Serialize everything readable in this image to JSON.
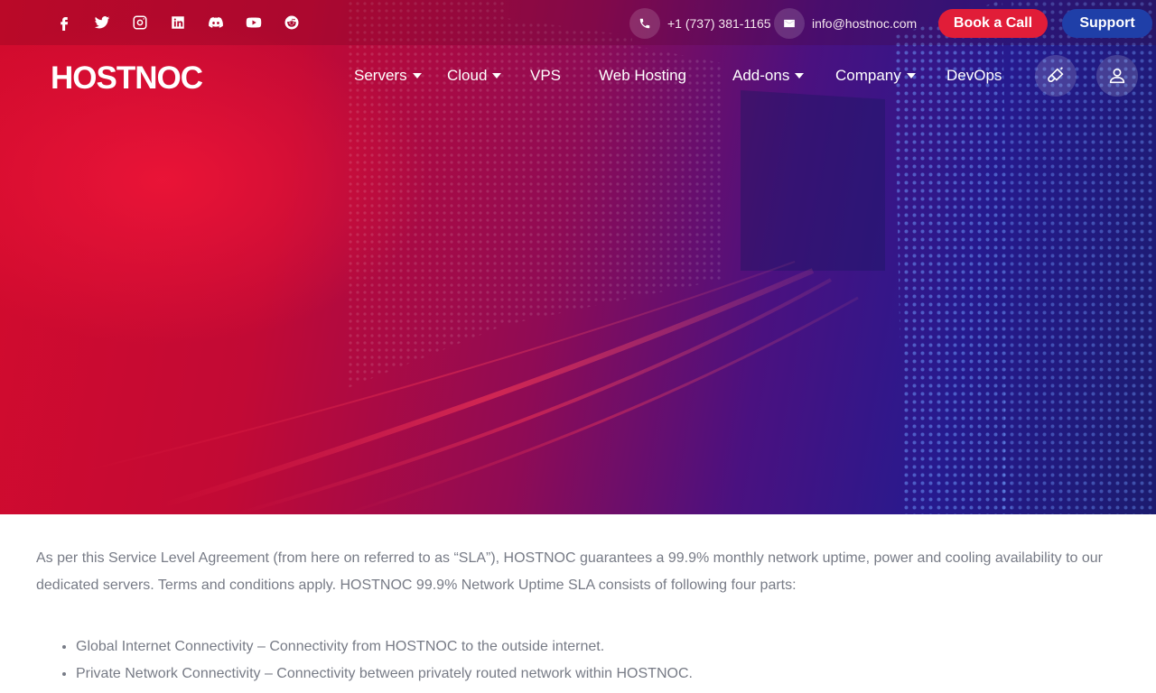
{
  "social": {
    "items": [
      "facebook-icon",
      "twitter-icon",
      "instagram-icon",
      "linkedin-icon",
      "discord-icon",
      "youtube-icon",
      "reddit-icon"
    ]
  },
  "contact": {
    "phone": "+1 (737) 381-1165",
    "email": "info@hostnoc.com"
  },
  "buttons": {
    "book": "Book a Call",
    "support": "Support"
  },
  "brand": {
    "logo_text": "HOSTNOC",
    "accent_red": "#e11d38",
    "support_blue": "#1f3fa8"
  },
  "nav": {
    "servers": "Servers",
    "cloud": "Cloud",
    "vps": "VPS",
    "web_hosting": "Web Hosting",
    "addons": "Add-ons",
    "company": "Company",
    "devops": "DevOps"
  },
  "content": {
    "intro": "As per this Service Level Agreement (from here on referred to as “SLA”), HOSTNOC guarantees a 99.9% monthly network uptime, power and cooling availability to our dedicated servers. Terms and conditions apply. HOSTNOC 99.9% Network Uptime SLA consists of following four parts:",
    "list": [
      "Global Internet Connectivity – Connectivity from HOSTNOC to the outside internet.",
      "Private Network Connectivity – Connectivity between privately routed network within HOSTNOC."
    ]
  }
}
